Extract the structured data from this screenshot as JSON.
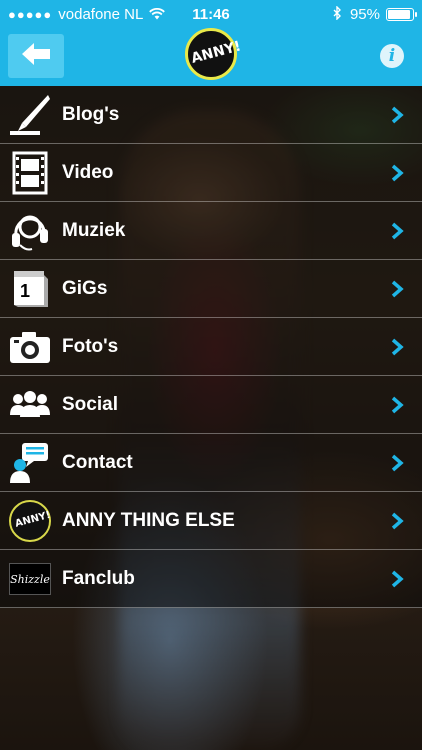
{
  "status_bar": {
    "signal": "●●●●●",
    "carrier": "vodafone NL",
    "time": "11:46",
    "battery_pct": "95%",
    "battery_level": 0.95
  },
  "header": {
    "back_icon": "arrow-left-icon",
    "logo_text": "ANNY!",
    "info_label": "i",
    "colors": {
      "bar": "#1fb5e6",
      "back_button": "#4fcbf0",
      "chevron": "#1fb5e6"
    }
  },
  "menu": {
    "items": [
      {
        "label": "Blog's",
        "icon": "pen-icon"
      },
      {
        "label": "Video",
        "icon": "film-icon"
      },
      {
        "label": "Muziek",
        "icon": "headphones-icon"
      },
      {
        "label": "GiGs",
        "icon": "calendar-icon"
      },
      {
        "label": "Foto's",
        "icon": "camera-icon"
      },
      {
        "label": "Social",
        "icon": "people-icon"
      },
      {
        "label": "Contact",
        "icon": "contact-icon"
      },
      {
        "label": "ANNY THING ELSE",
        "icon": "anny-logo-icon"
      },
      {
        "label": "Fanclub",
        "icon": "shizzle-logo-icon"
      }
    ],
    "calendar_day": "1",
    "shizzle_text": "Shizzle"
  }
}
